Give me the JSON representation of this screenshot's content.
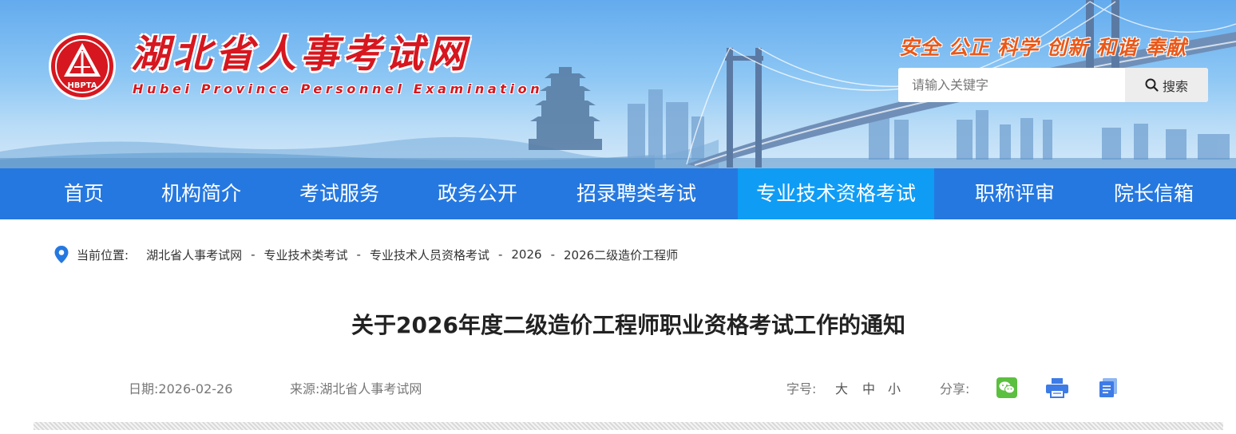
{
  "header": {
    "site_title": "湖北省人事考试网",
    "site_subtitle": "Hubei Province Personnel Examination",
    "seal_text": "HBPTA",
    "slogan": "安全 公正 科学 创新 和谐 奉献",
    "search": {
      "placeholder": "请输入关键字",
      "button_label": "搜索"
    }
  },
  "nav": {
    "items": [
      {
        "label": "首页"
      },
      {
        "label": "机构简介"
      },
      {
        "label": "考试服务"
      },
      {
        "label": "政务公开"
      },
      {
        "label": "招录聘类考试"
      },
      {
        "label": "专业技术资格考试"
      },
      {
        "label": "职称评审"
      },
      {
        "label": "院长信箱"
      }
    ],
    "active_index": 5
  },
  "breadcrumb": {
    "label": "当前位置:",
    "separator": "-",
    "items": [
      "湖北省人事考试网",
      "专业技术类考试",
      "专业技术人员资格考试",
      "2026",
      "2026二级造价工程师"
    ]
  },
  "article": {
    "title": "关于2026年度二级造价工程师职业资格考试工作的通知",
    "date_label": "日期:",
    "date": "2026-02-26",
    "source_label": "来源:",
    "source": "湖北省人事考试网",
    "font_size_label": "字号:",
    "font_sizes": [
      "大",
      "中",
      "小"
    ],
    "share_label": "分享:"
  },
  "colors": {
    "nav_bg": "#2578e0",
    "nav_active_bg": "#0f9cf5",
    "title_red": "#d6171f",
    "slogan_orange": "#e8591a",
    "wechat_green": "#5bbf3f",
    "share_blue": "#3d7be6"
  },
  "icons": [
    "hbpta-seal-logo",
    "search-icon",
    "location-pin-icon",
    "wechat-icon",
    "print-icon",
    "copy-icon"
  ]
}
